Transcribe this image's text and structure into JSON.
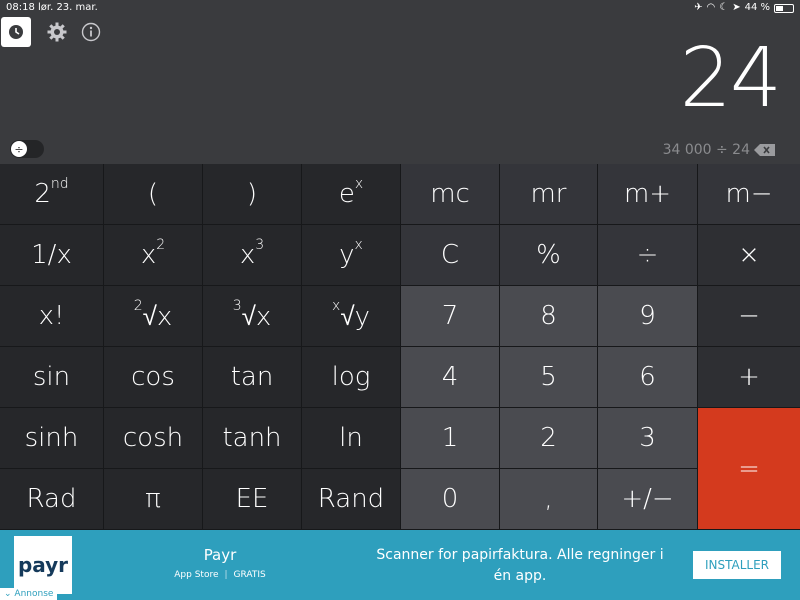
{
  "status_bar": {
    "time": "08:18",
    "date": "lør. 23. mar.",
    "battery": "44 %",
    "battery_level": 0.44
  },
  "toolbar": {
    "history_icon": "clock-icon",
    "settings_icon": "gear-icon",
    "info_icon": "info-icon"
  },
  "display": {
    "result": "24",
    "expression": "34 000  ÷  24"
  },
  "keys": {
    "r1": [
      "2",
      "(",
      ")",
      "e",
      "mc",
      "mr",
      "m+",
      "m−"
    ],
    "r1_sup": {
      "second": "nd",
      "ex": "x"
    },
    "r2": [
      "1/x",
      "x",
      "x",
      "y",
      "C",
      "%",
      "÷",
      "×"
    ],
    "r2_sup": {
      "sq": "2",
      "cube": "3",
      "yx": "x"
    },
    "r3": [
      "x!",
      "√x",
      "√x",
      "√y",
      "7",
      "8",
      "9",
      "−"
    ],
    "r3_sup": {
      "r2": "2",
      "r3": "3",
      "rx": "x"
    },
    "r4": [
      "sin",
      "cos",
      "tan",
      "log",
      "4",
      "5",
      "6",
      "+"
    ],
    "r5": [
      "sinh",
      "cosh",
      "tanh",
      "ln",
      "1",
      "2",
      "3",
      "="
    ],
    "r6": [
      "Rad",
      "π",
      "EE",
      "Rand",
      "0",
      ",",
      "+/−"
    ]
  },
  "ad": {
    "logo": "payr",
    "name": "Payr",
    "store": "App Store",
    "price": "GRATIS",
    "description": "Scanner for papirfaktura. Alle regninger i én app.",
    "install_label": "INSTALLER",
    "label": "Annonse"
  },
  "colors": {
    "equals": "#d43a1e",
    "ad_bg": "#2e9fbd"
  }
}
